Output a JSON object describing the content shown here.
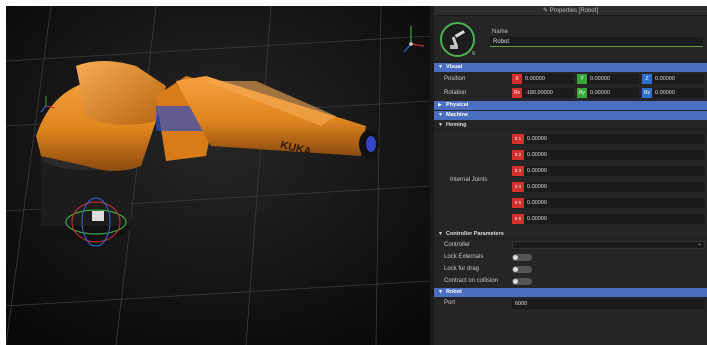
{
  "panel": {
    "title": "✎ Properties [Robot]",
    "name_label": "Name",
    "name_value": "Robot",
    "badge": "6",
    "sections": {
      "visual": "Visual",
      "physical": "Physical",
      "machine": "Machine",
      "homing": "Homing",
      "controller": "Controller Parameters",
      "robot": "Robot"
    },
    "position": {
      "label": "Position",
      "x_tag": "X",
      "x": "0.00000",
      "y_tag": "Y",
      "y": "0.00000",
      "z_tag": "Z",
      "z": "0.00000"
    },
    "rotation": {
      "label": "Rotation",
      "x_tag": "Rx",
      "x": "-180.00000",
      "y_tag": "Ry",
      "y": "0.00000",
      "z_tag": "Rz",
      "z": "0.00000"
    },
    "internal_joints": {
      "label": "Internal Joints",
      "joints": [
        {
          "tag": "0 1",
          "value": "0.00000"
        },
        {
          "tag": "0 2",
          "value": "0.00000"
        },
        {
          "tag": "0 3",
          "value": "0.00000"
        },
        {
          "tag": "0 4",
          "value": "0.00000"
        },
        {
          "tag": "0 5",
          "value": "0.00000"
        },
        {
          "tag": "0 6",
          "value": "0.00000"
        }
      ]
    },
    "controller": {
      "controller_label": "Controller",
      "lock_externals_label": "Lock Externals",
      "lock_for_drag_label": "Lock for drag",
      "contract_on_collision_label": "Contract on collision"
    },
    "robot": {
      "port_label": "Port",
      "port_value": "6000"
    }
  },
  "viewport": {
    "arm_label": "KUKA"
  },
  "colors": {
    "section_blue": "#4a6fc2",
    "robot_orange": "#e0861f",
    "name_underline": "#6a9e3a"
  }
}
